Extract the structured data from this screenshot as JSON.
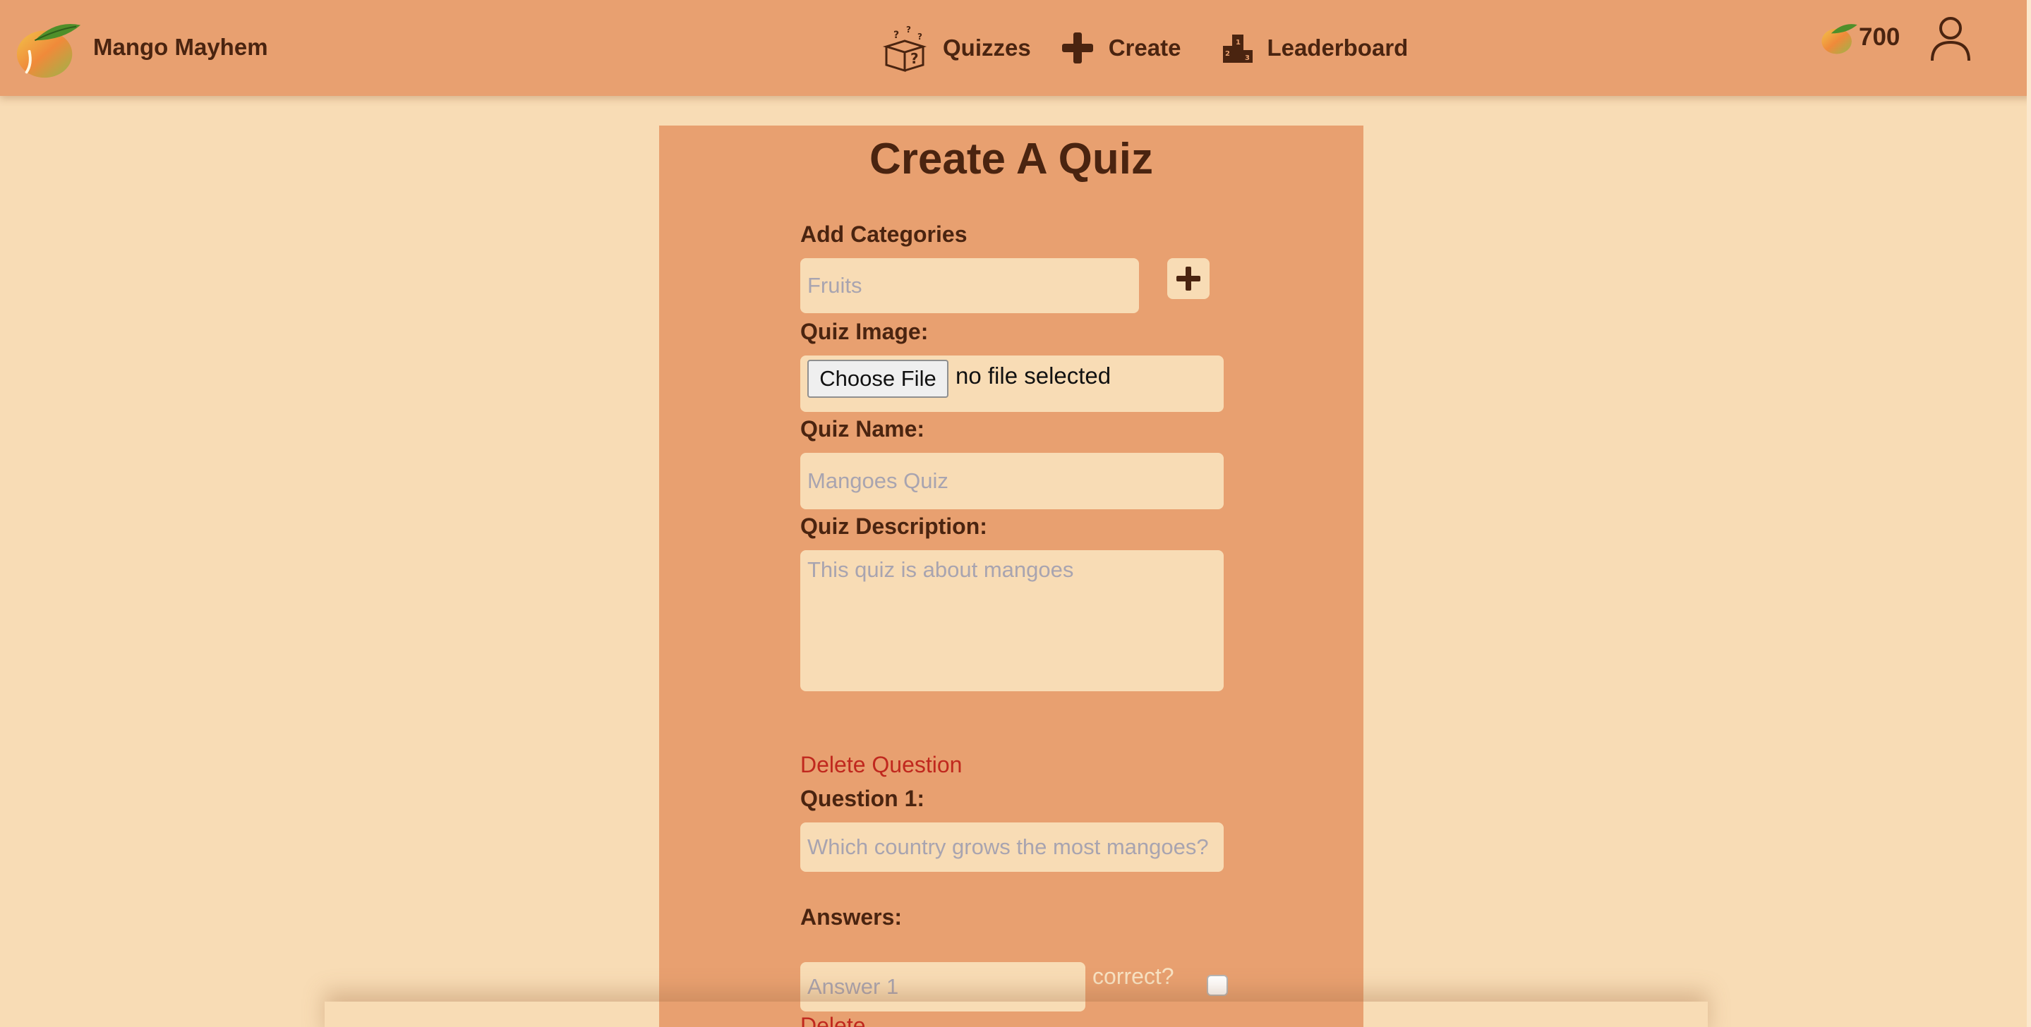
{
  "header": {
    "brand_name": "Mango Mayhem",
    "nav": [
      {
        "label": "Quizzes",
        "icon": "quiz-dice-icon"
      },
      {
        "label": "Create",
        "icon": "plus-icon"
      },
      {
        "label": "Leaderboard",
        "icon": "podium-icon"
      }
    ],
    "coins": "700",
    "colors": {
      "header_bg": "#e8a070",
      "page_bg": "#f8dcb5",
      "text": "#4a2410",
      "danger": "#c0281e"
    }
  },
  "form": {
    "title": "Create A Quiz",
    "categories_label": "Add Categories",
    "categories_placeholder": "Fruits",
    "image_label": "Quiz Image:",
    "choose_file_label": "Choose File",
    "file_status": "no file selected",
    "name_label": "Quiz Name:",
    "name_placeholder": "Mangoes Quiz",
    "description_label": "Quiz Description:",
    "description_placeholder": "This quiz is about mangoes",
    "delete_question": "Delete Question",
    "question_label": "Question 1:",
    "question_placeholder": "Which country grows the most mangoes?",
    "answers_label": "Answers:",
    "answer_placeholder": "Answer 1",
    "correct_label": "correct?",
    "delete_answer": "Delete"
  }
}
